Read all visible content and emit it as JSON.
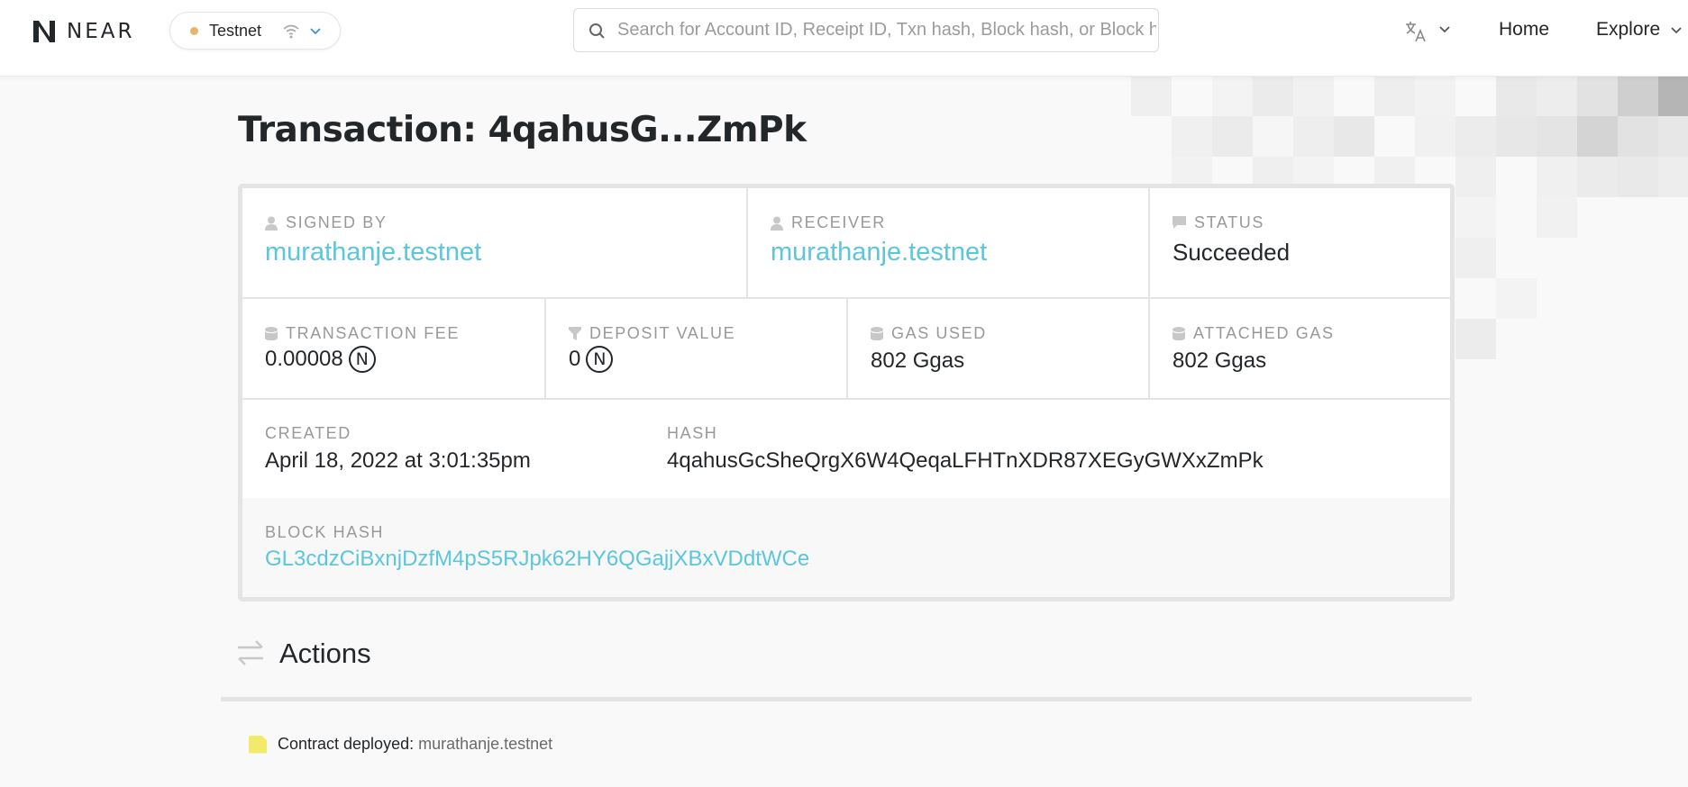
{
  "header": {
    "logo_text": "NEAR",
    "network": {
      "label": "Testnet",
      "dot_color": "#e8b36a"
    },
    "search": {
      "placeholder": "Search for Account ID, Receipt ID, Txn hash, Block hash, or Block height",
      "value": ""
    },
    "nav": {
      "home": "Home",
      "explore": "Explore"
    }
  },
  "page": {
    "title": "Transaction: 4qahusG...ZmPk"
  },
  "details": {
    "signed_by": {
      "label": "SIGNED BY",
      "value": "murathanje.testnet"
    },
    "receiver": {
      "label": "RECEIVER",
      "value": "murathanje.testnet"
    },
    "status": {
      "label": "STATUS",
      "value": "Succeeded"
    },
    "transaction_fee": {
      "label": "TRANSACTION FEE",
      "value": "0.00008",
      "unit": "N"
    },
    "deposit_value": {
      "label": "DEPOSIT VALUE",
      "value": "0",
      "unit": "N"
    },
    "gas_used": {
      "label": "GAS USED",
      "value": "802 Ggas"
    },
    "attached_gas": {
      "label": "ATTACHED GAS",
      "value": "802 Ggas"
    },
    "created": {
      "label": "CREATED",
      "value": "April 18, 2022 at 3:01:35pm"
    },
    "hash": {
      "label": "HASH",
      "value": "4qahusGcSheQrgX6W4QeqaLFHTnXDR87XEGyGWXxZmPk"
    },
    "block_hash": {
      "label": "BLOCK HASH",
      "value": "GL3cdzCiBxnjDzfM4pS5RJpk62HY6QGajjXBxVDdtWCe"
    }
  },
  "actions": {
    "title": "Actions",
    "items": [
      {
        "text": "Contract deployed:",
        "account": "murathanje.testnet",
        "icon": "file-icon",
        "icon_color": "#f2ea6a"
      }
    ]
  },
  "colors": {
    "link": "#5bc6dc",
    "border": "#e4e4e4",
    "label": "#999999"
  }
}
